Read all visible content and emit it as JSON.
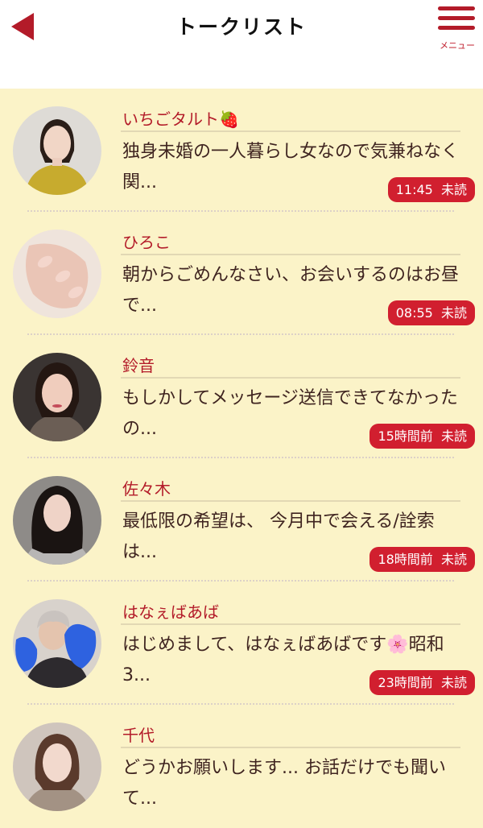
{
  "header": {
    "title": "トークリスト",
    "menu_label": "メニュー"
  },
  "colors": {
    "accent": "#b31b29",
    "badge": "#d11f2f",
    "background": "#fbf3c8"
  },
  "conversations": [
    {
      "name": "いちごタルト🍓",
      "message": "独身未婚の一人暮らし女なので気兼ねなく関...",
      "time": "11:45",
      "status": "未読"
    },
    {
      "name": "ひろこ",
      "message": "朝からごめんなさい、お会いするのはお昼で...",
      "time": "08:55",
      "status": "未読"
    },
    {
      "name": "鈴音",
      "message": "もしかしてメッセージ送信できてなかったの...",
      "time": "15時間前",
      "status": "未読"
    },
    {
      "name": "佐々木",
      "message": "最低限の希望は、 今月中で会える/詮索は...",
      "time": "18時間前",
      "status": "未読"
    },
    {
      "name": "はなぇばあば",
      "message": "はじめまして、はなぇばあばです🌸昭和3...",
      "time": "23時間前",
      "status": "未読"
    },
    {
      "name": "千代",
      "message": "どうかお願いします... お話だけでも聞いて...",
      "time": "",
      "status": ""
    }
  ]
}
